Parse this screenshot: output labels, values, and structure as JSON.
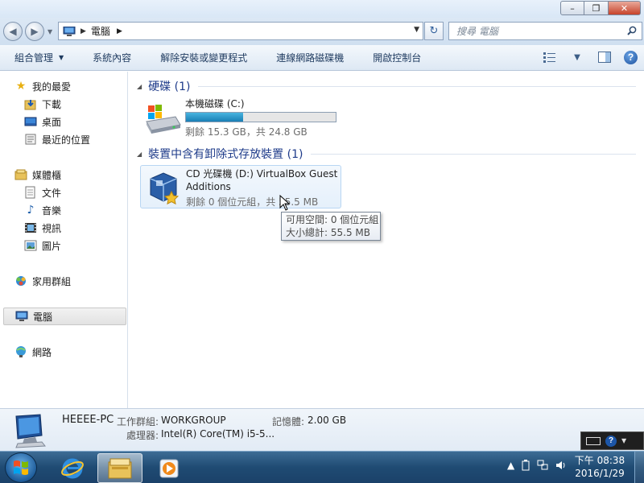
{
  "window": {
    "minimize_label": "–",
    "maximize_label": "❐",
    "close_label": "✕"
  },
  "address": {
    "location": "電腦",
    "search_placeholder": "搜尋 電腦"
  },
  "toolbar": {
    "items": [
      {
        "label": "組合管理",
        "has_dropdown": true
      },
      {
        "label": "系統內容"
      },
      {
        "label": "解除安裝或變更程式"
      },
      {
        "label": "連線網路磁碟機"
      },
      {
        "label": "開啟控制台"
      }
    ]
  },
  "sidebar": {
    "favorites": {
      "label": "我的最愛",
      "items": [
        "下載",
        "桌面",
        "最近的位置"
      ]
    },
    "libraries": {
      "label": "媒體櫃",
      "items": [
        "文件",
        "音樂",
        "視訊",
        "圖片"
      ]
    },
    "homegroup": "家用群組",
    "computer": "電腦",
    "network": "網路",
    "selected": "電腦"
  },
  "groups": [
    {
      "header": "硬碟 (1)",
      "drives": [
        {
          "name": "本機磁碟 (C:)",
          "free_text": "剩餘 15.3 GB，共 24.8 GB",
          "used_fraction": 0.383
        }
      ]
    },
    {
      "header": "裝置中含有卸除式存放裝置 (1)",
      "drives": [
        {
          "name": "CD 光碟機 (D:) VirtualBox Guest Additions",
          "free_text": "剩餘 0 個位元組，共 55.5 MB"
        }
      ]
    }
  ],
  "tooltip": {
    "line1": "可用空間: 0 個位元組",
    "line2": "大小總計: 55.5 MB"
  },
  "details": {
    "pc_name": "HEEEE-PC",
    "workgroup_label": "工作群組:",
    "workgroup_value": "WORKGROUP",
    "memory_label": "記憶體:",
    "memory_value": "2.00 GB",
    "processor_label": "處理器:",
    "processor_value": "Intel(R) Core(TM) i5-5..."
  },
  "taskbar": {
    "time": "下午 08:38",
    "date": "2016/1/29"
  },
  "colors": {
    "accent_header": "#1e3b8a",
    "drive_bar": "#1a7fb5",
    "taskbar": "#1f4b73"
  }
}
